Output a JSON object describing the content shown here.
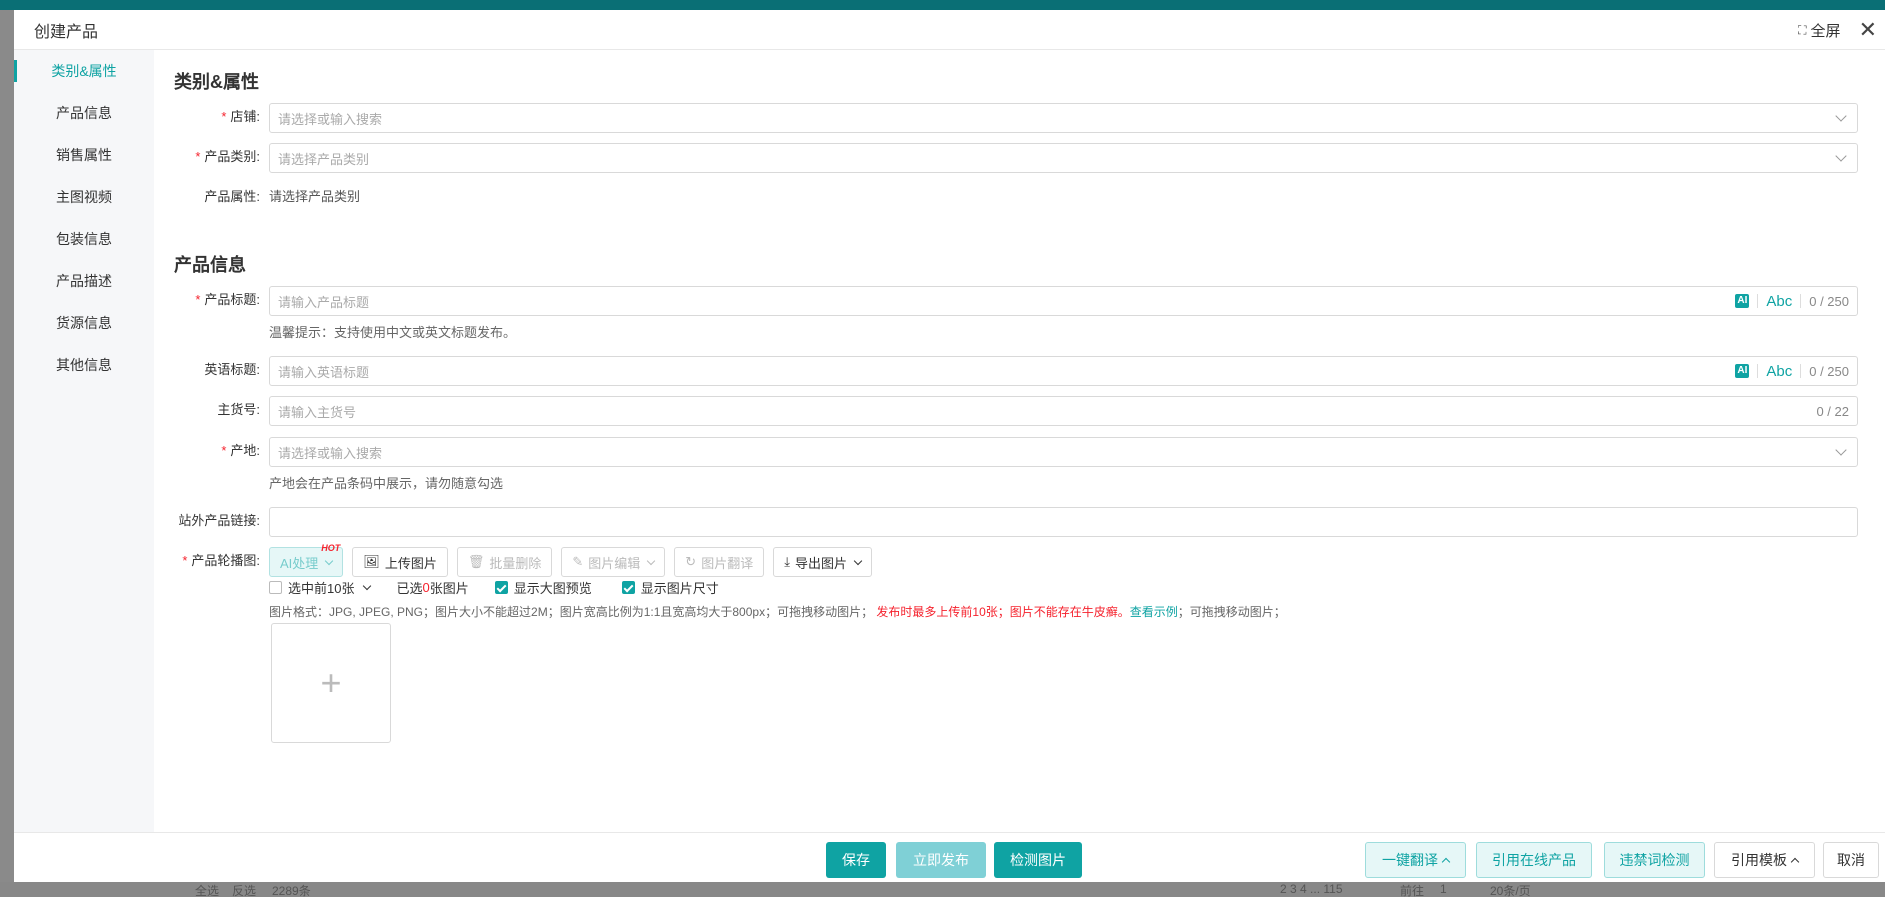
{
  "modal": {
    "title": "创建产品",
    "fullscreen_label": "全屏"
  },
  "nav": {
    "items": [
      "类别&属性",
      "产品信息",
      "销售属性",
      "主图视频",
      "包装信息",
      "产品描述",
      "货源信息",
      "其他信息"
    ],
    "active_index": 0
  },
  "section_category": {
    "title": "类别&属性",
    "store_label": "店铺:",
    "store_placeholder": "请选择或输入搜索",
    "category_label": "产品类别:",
    "category_placeholder": "请选择产品类别",
    "attr_label": "产品属性:",
    "attr_value": "请选择产品类别"
  },
  "section_product": {
    "title": "产品信息",
    "title_label": "产品标题:",
    "title_placeholder": "请输入产品标题",
    "title_count": "0 / 250",
    "title_hint": "温馨提示：支持使用中文或英文标题发布。",
    "ai_badge": "AI",
    "abc_label": "Abc",
    "en_title_label": "英语标题:",
    "en_title_placeholder": "请输入英语标题",
    "en_title_count": "0 / 250",
    "sku_label": "主货号:",
    "sku_placeholder": "请输入主货号",
    "sku_count": "0 / 22",
    "origin_label": "产地:",
    "origin_placeholder": "请选择或输入搜索",
    "origin_hint": "产地会在产品条码中展示，请勿随意勾选",
    "external_link_label": "站外产品链接:",
    "carousel_label": "产品轮播图:"
  },
  "carousel_toolbar": {
    "ai_process": "AI处理",
    "hot": "HOT",
    "upload": "上传图片",
    "batch_delete": "批量删除",
    "image_edit": "图片编辑",
    "image_translate": "图片翻译",
    "export_images": "导出图片"
  },
  "carousel_options": {
    "select_first": "选中前10张",
    "selected_prefix": "已选",
    "selected_count": "0",
    "selected_suffix": "张图片",
    "show_large_preview": "显示大图预览",
    "show_image_size": "显示图片尺寸",
    "format_text": "图片格式：JPG, JPEG, PNG；图片大小不能超过2M；图片宽高比例为1:1且宽高均大于800px；可拖拽移动图片；",
    "format_warning": "发布时最多上传前10张；图片不能存在牛皮癣。",
    "format_link": "查看示例",
    "format_tail": "；可拖拽移动图片；",
    "upload_plus": "+"
  },
  "footer": {
    "save": "保存",
    "publish": "立即发布",
    "check_images": "检测图片",
    "translate_all": "一键翻译",
    "reference_online": "引用在线产品",
    "banned_words": "违禁词检测",
    "reference_template": "引用模板",
    "cancel": "取消"
  },
  "background_page": {
    "left_buttons": [
      "全选",
      "反选"
    ],
    "total_text": "2289条",
    "pager_text": "2  3  4  ...  115",
    "goto": "前往",
    "goto_page": "1",
    "per_page": "20条/页"
  },
  "colors": {
    "accent": "#0fa3a3",
    "required": "#f5222d"
  }
}
